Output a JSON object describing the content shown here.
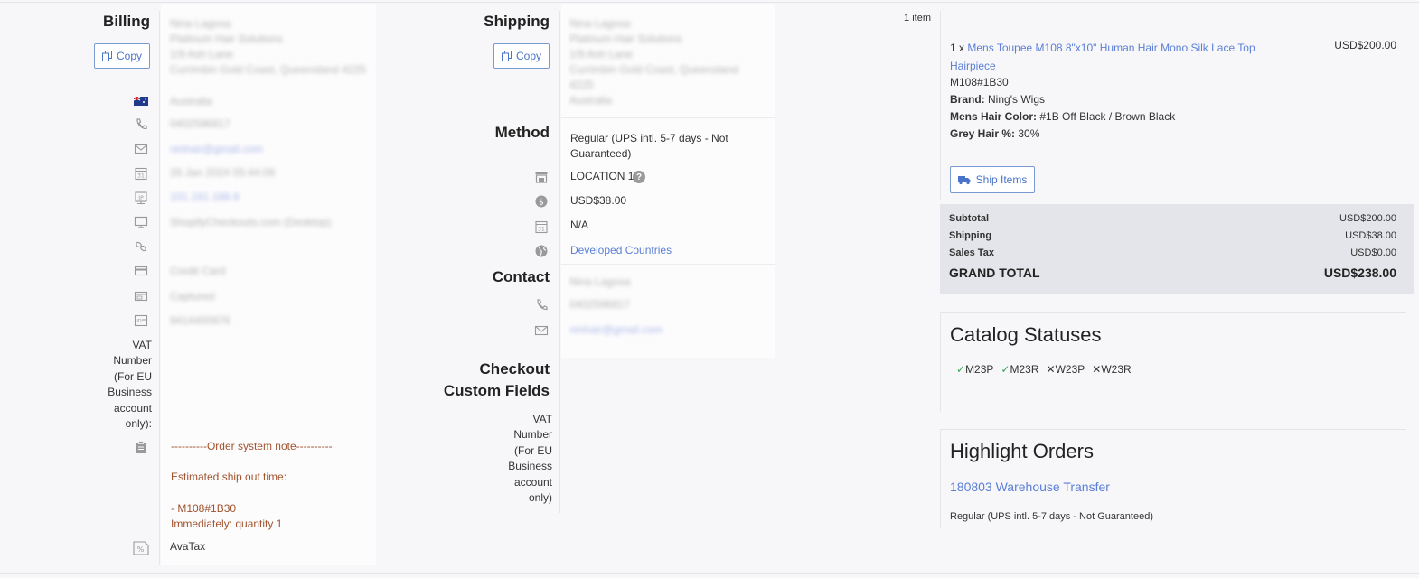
{
  "billing": {
    "title": "Billing",
    "copy_label": "Copy",
    "address_lines": [
      "Nina Lagosa",
      "Platinum Hair Solutions",
      "1/9 Ash Lane",
      "Currimbin Gold Coast, Queensland 4225",
      "Australia"
    ],
    "phone": "0402596817",
    "email": "ninhair@gmail.com",
    "date": "28 Jan 2024 05:44:09",
    "ip": "101.191.188.8",
    "browser": "ShopifyCheckouts.com (Desktop)",
    "payment": [
      "Credit Card",
      "Captured",
      "9414400976"
    ],
    "vat_label": "VAT Number (For EU Business account only):",
    "note_header": "----------Order system note----------",
    "note_ship": "Estimated ship out time:",
    "note_item": "- M108#1B30",
    "note_qty": "Immediately: quantity 1",
    "tax_label": "AvaTax"
  },
  "shipping": {
    "title": "Shipping",
    "copy_label": "Copy",
    "address_lines": [
      "Nina Lagosa",
      "Platinum Hair Solutions",
      "1/9 Ash Lane",
      "Currimbin Gold Coast, Queensland",
      "4225",
      "Australia"
    ],
    "method_title": "Method",
    "method_line1": "Regular (UPS intl. 5-7 days - Not",
    "method_line2": "Guaranteed)",
    "location": "LOCATION 1",
    "cost": "USD$38.00",
    "date": "N/A",
    "zone": "Developed Countries",
    "contact_title": "Contact",
    "contact_name": "Nina Lagosa",
    "contact_phone": "0402596817",
    "contact_email": "ninhair@gmail.com",
    "custom_title_1": "Checkout",
    "custom_title_2": "Custom Fields",
    "vat_label": "VAT Number (For EU Business account only)"
  },
  "order": {
    "item_count": "1 item",
    "qty": "1 x",
    "product_line1": "Mens Toupee M108 8\"x10\" Human Hair Mono Silk Lace Top",
    "product_line2": "Hairpiece",
    "price": "USD$200.00",
    "sku": "M108#1B30",
    "brand_label": "Brand:",
    "brand": "Ning's Wigs",
    "color_label": "Mens Hair Color:",
    "color": "#1B Off Black / Brown Black",
    "grey_label": "Grey Hair %:",
    "grey": "30%",
    "ship_button": "Ship Items"
  },
  "totals": {
    "subtotal_label": "Subtotal",
    "subtotal": "USD$200.00",
    "shipping_label": "Shipping",
    "shipping": "USD$38.00",
    "tax_label": "Sales Tax",
    "tax": "USD$0.00",
    "grand_label": "GRAND TOTAL",
    "grand": "USD$238.00"
  },
  "catalog": {
    "title": "Catalog Statuses",
    "statuses": [
      {
        "mark": "✓",
        "label": "M23P",
        "color": "#3aa35a"
      },
      {
        "mark": "✓",
        "label": "M23R",
        "color": "#3aa35a"
      },
      {
        "mark": "✕",
        "label": "W23P",
        "color": "#333333"
      },
      {
        "mark": "✕",
        "label": "W23R",
        "color": "#333333"
      }
    ]
  },
  "highlight": {
    "title": "Highlight Orders",
    "link": "180803 Warehouse Transfer",
    "method": "Regular (UPS intl. 5-7 days - Not Guaranteed)"
  }
}
